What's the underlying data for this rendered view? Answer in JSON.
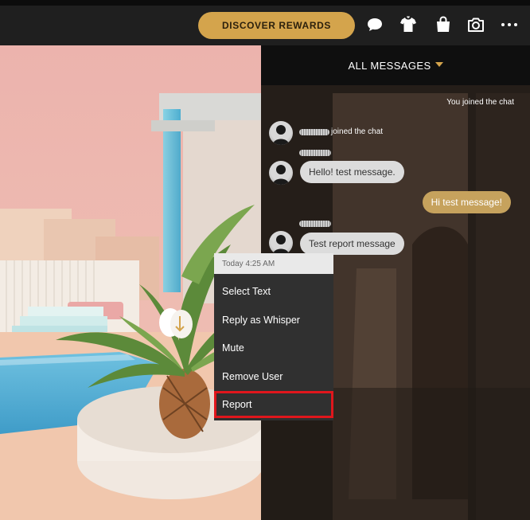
{
  "topbar": {
    "rewards_label": "DISCOVER REWARDS",
    "icons": [
      "chat-bubble-icon",
      "shirt-icon",
      "shopping-bag-icon",
      "camera-icon",
      "more-icon"
    ]
  },
  "chat": {
    "header": "ALL MESSAGES",
    "system_message": "You joined the chat",
    "joined_suffix": "joined the chat",
    "messages": [
      "Hello! test message.",
      "Hi test message!",
      "Test report message"
    ]
  },
  "context_menu": {
    "timestamp": "Today 4:25 AM",
    "items": [
      "Select Text",
      "Reply as Whisper",
      "Mute",
      "Remove User",
      "Report"
    ]
  },
  "colors": {
    "accent_gold": "#d4a44c",
    "highlight_red": "#e0161c"
  }
}
